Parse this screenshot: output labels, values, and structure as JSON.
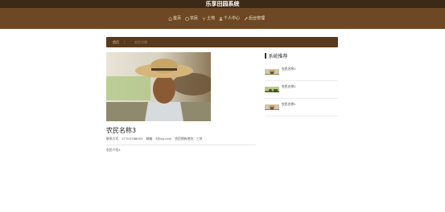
{
  "site": {
    "title": "乐享田园系统"
  },
  "nav": [
    {
      "label": "首页",
      "icon": "home-icon"
    },
    {
      "label": "农民",
      "icon": "user-icon"
    },
    {
      "label": "土地",
      "icon": "plant-icon"
    },
    {
      "label": "个人中心",
      "icon": "person-icon"
    },
    {
      "label": "后台管理",
      "icon": "wrench-icon"
    }
  ],
  "breadcrumb": {
    "home": "首页",
    "separator": "/",
    "current": "农民详情"
  },
  "farmer": {
    "name": "农民名称3",
    "contact_label": "联系方式：",
    "phone": "17703788003",
    "email_label": "邮箱：",
    "email": "3@qq.com",
    "land_label": "农民拥有地块：",
    "land": "三块",
    "intro": "农民介绍3"
  },
  "sidebar": {
    "title": "系统推荐",
    "items": [
      {
        "name": "农民名称1"
      },
      {
        "name": "农民名称2"
      },
      {
        "name": "农民名称1"
      }
    ]
  },
  "colors": {
    "nav_bg": "#6e4824",
    "topbar_bg": "#3b2a16",
    "crumb_bg": "#5a3a1c"
  }
}
